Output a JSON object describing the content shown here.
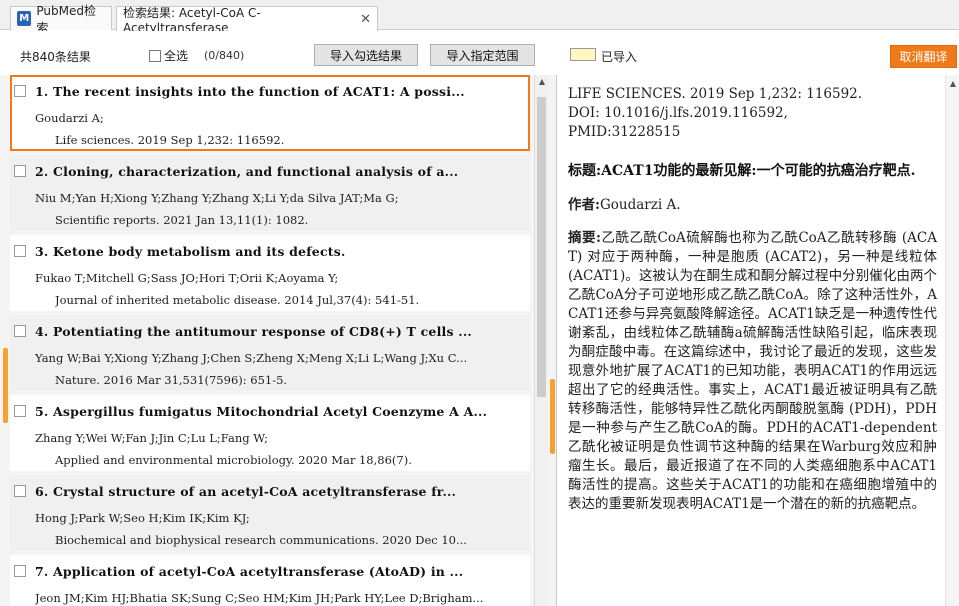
{
  "tabs": [
    {
      "label": "PubMed检索",
      "icon": "pubmed-logo-icon"
    },
    {
      "label": "检索结果: Acetyl-CoA C-Acetyltransferase",
      "close": "✕"
    }
  ],
  "toolbar": {
    "total": "共840条结果",
    "select_all": "全选",
    "selected_count": "(0/840)",
    "import_selected": "导入勾选结果",
    "import_range": "导入指定范围",
    "imported_legend": "已导入",
    "cancel_translate": "取消翻译"
  },
  "results": [
    {
      "title": "1. The recent insights into the function of ACAT1: A possi...",
      "authors": "Goudarzi A;",
      "journal": "Life sciences. 2019 Sep 1,232: 116592."
    },
    {
      "title": "2. Cloning, characterization, and functional analysis of a...",
      "authors": "Niu M;Yan H;Xiong Y;Zhang Y;Zhang X;Li Y;da Silva JAT;Ma G;",
      "journal": "Scientific reports. 2021 Jan 13,11(1): 1082."
    },
    {
      "title": "3. Ketone body metabolism and its defects.",
      "authors": "Fukao T;Mitchell G;Sass JO;Hori T;Orii K;Aoyama Y;",
      "journal": "Journal of inherited metabolic disease. 2014 Jul,37(4): 541-51."
    },
    {
      "title": "4. Potentiating the antitumour response of CD8(+) T cells ...",
      "authors": "Yang W;Bai Y;Xiong Y;Zhang J;Chen S;Zheng X;Meng X;Li L;Wang J;Xu C...",
      "journal": "Nature. 2016 Mar 31,531(7596): 651-5."
    },
    {
      "title": "5. Aspergillus fumigatus Mitochondrial Acetyl Coenzyme A A...",
      "authors": "Zhang Y;Wei W;Fan J;Jin C;Lu L;Fang W;",
      "journal": "Applied and environmental microbiology. 2020 Mar 18,86(7)."
    },
    {
      "title": "6. Crystal structure of an acetyl-CoA acetyltransferase fr...",
      "authors": "Hong J;Park W;Seo H;Kim IK;Kim KJ;",
      "journal": "Biochemical and biophysical research communications. 2020 Dec 10..."
    },
    {
      "title": "7. Application of acetyl-CoA acetyltransferase (AtoAD) in ...",
      "authors": "Jeon JM;Kim HJ;Bhatia SK;Sung C;Seo HM;Kim JH;Park HY;Lee D;Brigham...",
      "journal": ""
    }
  ],
  "detail": {
    "source": "LIFE SCIENCES. 2019 Sep 1,232: 116592.",
    "doi": "DOI: 10.1016/j.lfs.2019.116592,",
    "pmid": "PMID:31228515",
    "title_label": "标题:",
    "title": "ACAT1功能的最新见解:一个可能的抗癌治疗靶点.",
    "author_label": "作者:",
    "author": "Goudarzi A.",
    "abstract_label": "摘要:",
    "abstract": "乙酰乙酰CoA硫解酶也称为乙酰CoA乙酰转移酶 (ACAT) 对应于两种酶，一种是胞质 (ACAT2)，另一种是线粒体 (ACAT1)。这被认为在酮生成和酮分解过程中分别催化由两个乙酰CoA分子可逆地形成乙酰乙酰CoA。除了这种活性外，ACAT1还参与异亮氨酸降解途径。ACAT1缺乏是一种遗传性代谢紊乱，由线粒体乙酰辅酶a硫解酶活性缺陷引起，临床表现为酮症酸中毒。在这篇综述中，我讨论了最近的发现，这些发现意外地扩展了ACAT1的已知功能，表明ACAT1的作用远远超出了它的经典活性。事实上，ACAT1最近被证明具有乙酰转移酶活性，能够特异性乙酰化丙酮酸脱氢酶 (PDH)，PDH是一种参与产生乙酰CoA的酶。PDH的ACAT1-dependent乙酰化被证明是负性调节这种酶的结果在Warburg效应和肿瘤生长。最后，最近报道了在不同的人类癌细胞系中ACAT1酶活性的提高。这些关于ACAT1的功能和在癌细胞增殖中的表达的重要新发现表明ACAT1是一个潜在的新的抗癌靶点。"
  },
  "colors": {
    "accent": "#f07a1a",
    "imported": "#fff7c2",
    "marker": "#f7a032"
  }
}
